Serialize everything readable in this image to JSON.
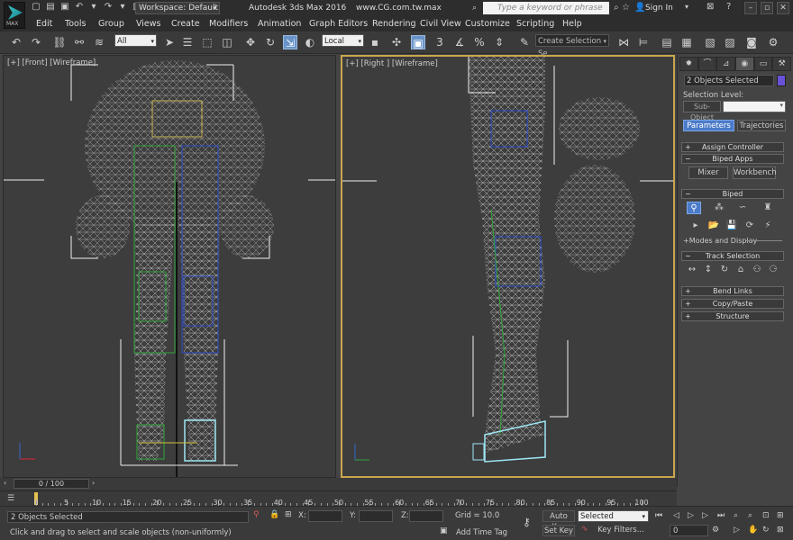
{
  "app": {
    "logo_text": "MAX",
    "workspace_label": "Workspace: Default",
    "title": "Autodesk 3ds Max 2016",
    "website": "www.CG.com.tw.max",
    "search_placeholder": "Type a keyword or phrase",
    "signin_label": "Sign In"
  },
  "menu": [
    "Edit",
    "Tools",
    "Group",
    "Views",
    "Create",
    "Modifiers",
    "Animation",
    "Graph Editors",
    "Rendering",
    "Civil View",
    "Customize",
    "Scripting",
    "Help"
  ],
  "toolbar": {
    "selection_filter": "All",
    "reference_coord": "Local",
    "snap_angle": "3",
    "named_selection_placeholder": "Create Selection Se"
  },
  "viewports": {
    "front_label": "[+] [Front] [Wireframe]",
    "right_label": "[+] [Right ] [Wireframe]"
  },
  "command_panel": {
    "object_name": "2 Objects Selected",
    "selection_level_label": "Selection Level:",
    "sub_object_label": "Sub-Object",
    "tab_parameters": "Parameters",
    "tab_trajectories": "Trajectories",
    "rollout_assign_controller": "Assign Controller",
    "rollout_biped_apps": "Biped Apps",
    "button_mixer": "Mixer",
    "button_workbench": "Workbench",
    "rollout_biped": "Biped",
    "modes_display": "Modes and Display",
    "rollout_track_selection": "Track Selection",
    "rollout_bend_links": "Bend Links",
    "rollout_copy_paste": "Copy/Paste",
    "rollout_structure": "Structure",
    "accent_color": "#4b7bc9",
    "object_color": "#6a52d8"
  },
  "timeline": {
    "time_slider": "0 / 100",
    "ticks": [
      "0",
      "5",
      "10",
      "15",
      "20",
      "25",
      "30",
      "35",
      "40",
      "45",
      "50",
      "55",
      "60",
      "65",
      "70",
      "75",
      "80",
      "85",
      "90",
      "95",
      "100"
    ]
  },
  "status": {
    "selection_info": "2 Objects Selected",
    "prompt": "Click and drag to select and scale objects (non-uniformly)",
    "x_label": "X:",
    "y_label": "Y:",
    "z_label": "Z:",
    "grid": "Grid = 10.0",
    "add_time_tag": "Add Time Tag",
    "auto_key": "Auto Key",
    "set_key": "Set Key",
    "key_mode": "Selected",
    "key_filters": "Key Filters...",
    "current_frame": "0"
  }
}
